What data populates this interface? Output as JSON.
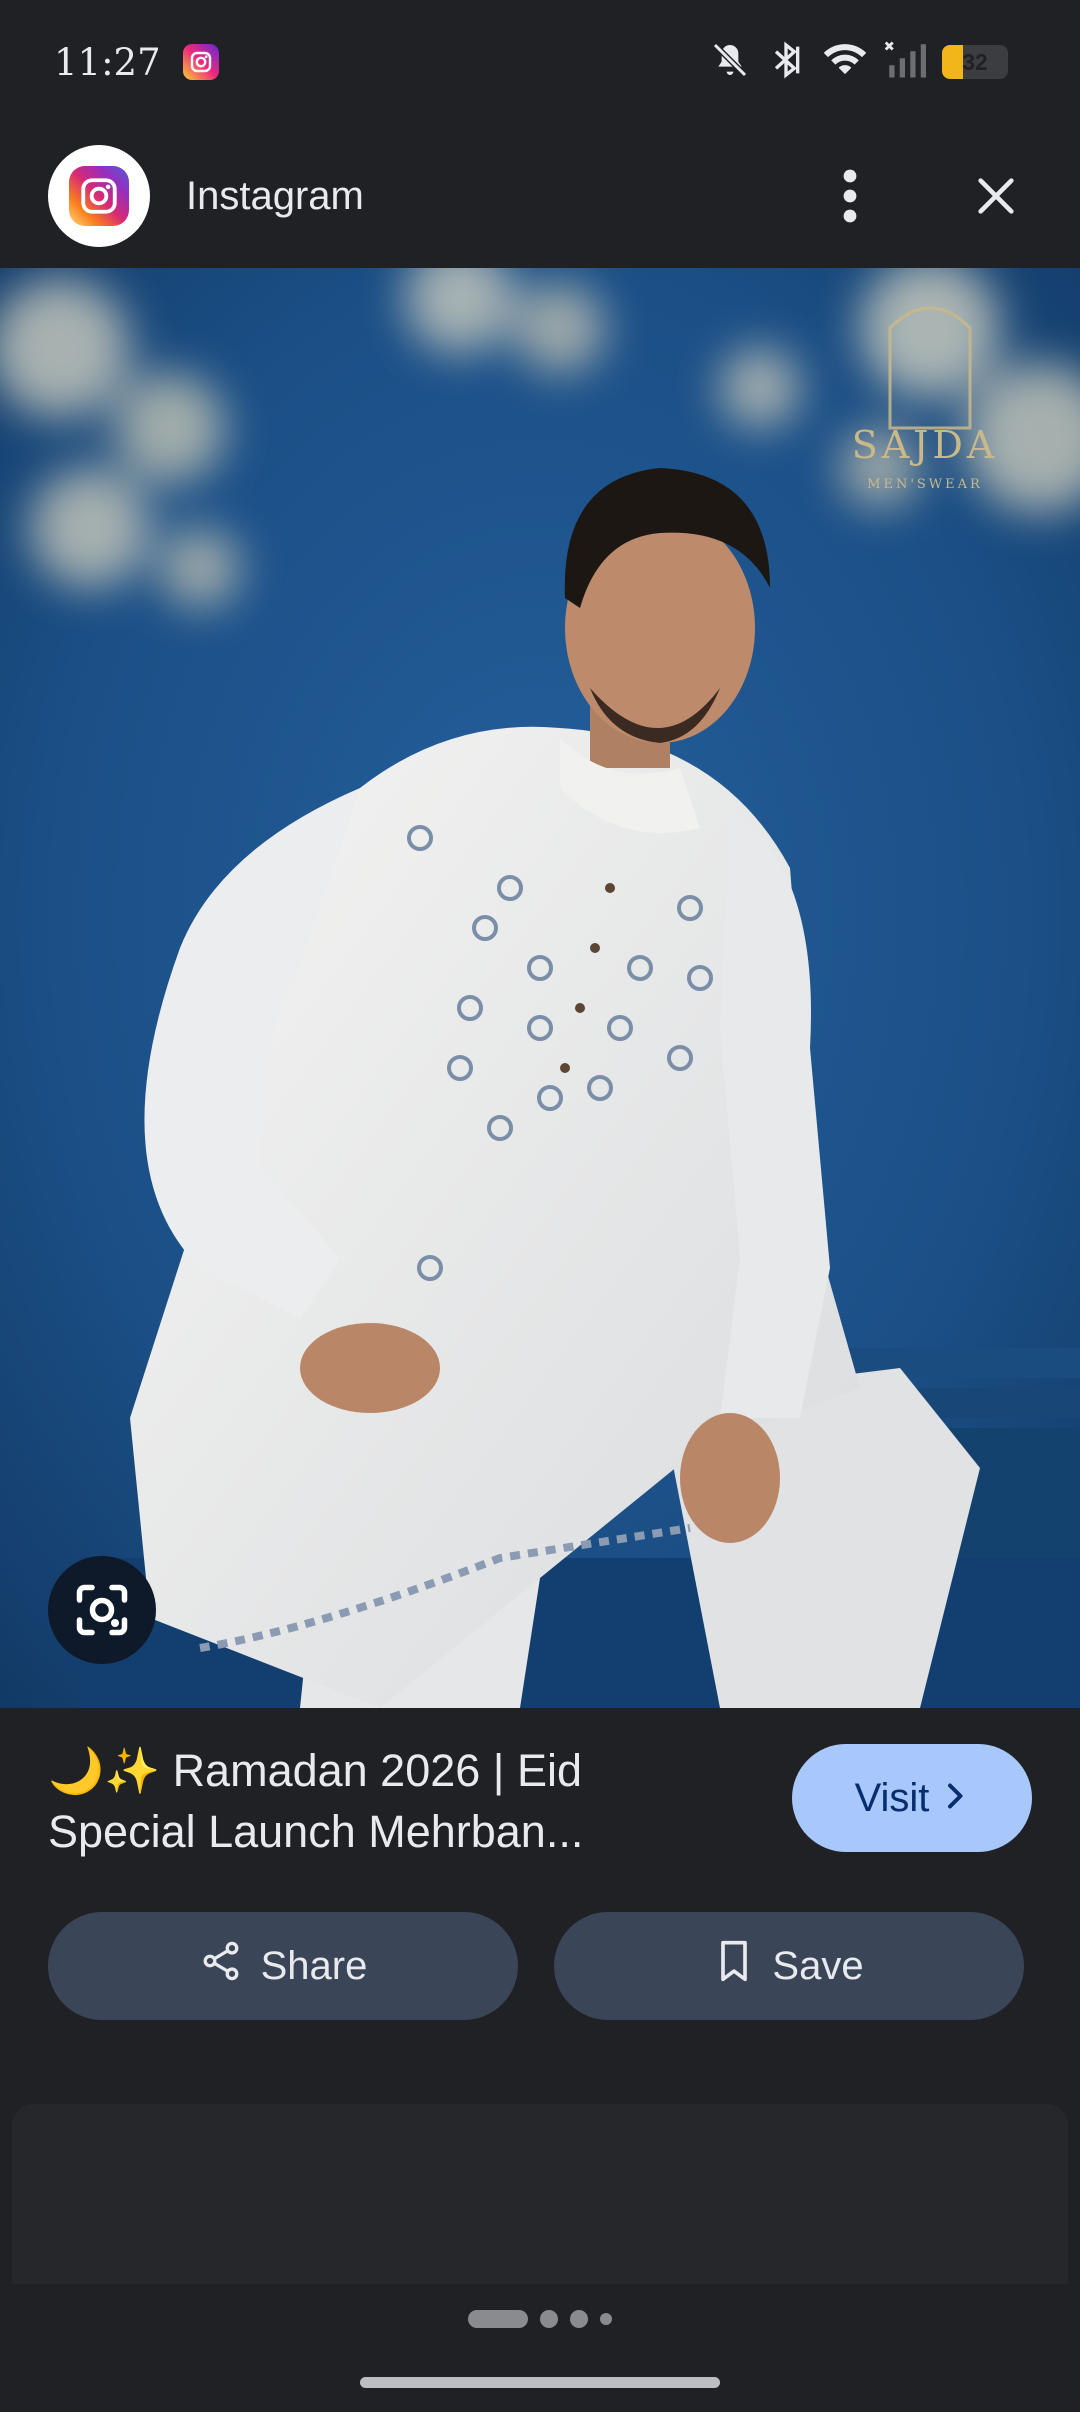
{
  "status_bar": {
    "time": "11:27",
    "battery_level": "32",
    "battery_fraction": 0.32,
    "icons": [
      "instagram-notification-icon",
      "mute-icon",
      "bluetooth-icon",
      "wifi-icon",
      "signal-icon",
      "battery-icon"
    ]
  },
  "header": {
    "app_name": "Instagram",
    "more_icon": "more-vertical-icon",
    "close_icon": "close-icon"
  },
  "hero_image": {
    "description_icon": "image",
    "brand_watermark": "SAJDA",
    "brand_sub": "MEN'SWEAR"
  },
  "caption": {
    "line1": "🌙✨ Ramadan 2026 | Eid",
    "line2": "Special Launch Mehrban..."
  },
  "buttons": {
    "visit_label": "Visit",
    "share_label": "Share",
    "save_label": "Save"
  },
  "pagination": {
    "total": 4,
    "current": 1
  },
  "colors": {
    "background": "#202125",
    "visit_bg": "#a8c7fa",
    "action_bg": "#3a4557",
    "backdrop_blue": "#1b4f86"
  }
}
